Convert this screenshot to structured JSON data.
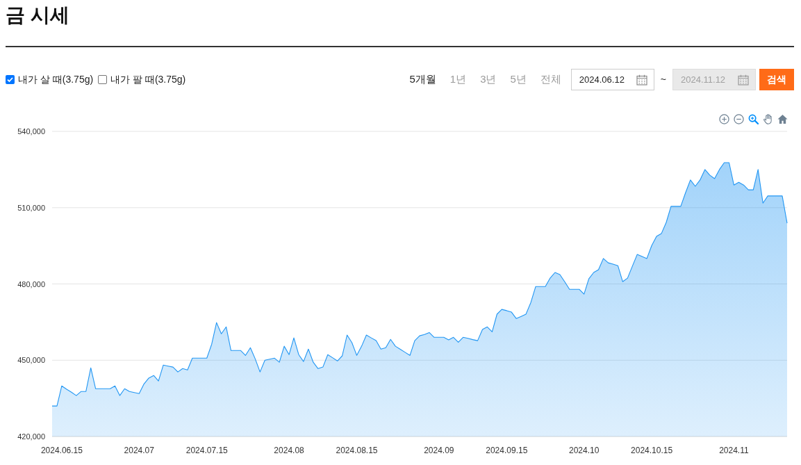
{
  "page": {
    "title": "금 시세"
  },
  "filters": [
    {
      "label": "내가 살 때(3.75g)",
      "checked": true
    },
    {
      "label": "내가 팔 때(3.75g)",
      "checked": false
    }
  ],
  "periods": [
    {
      "label": "5개월",
      "selected": true
    },
    {
      "label": "1년",
      "selected": false
    },
    {
      "label": "3년",
      "selected": false
    },
    {
      "label": "5년",
      "selected": false
    },
    {
      "label": "전체",
      "selected": false
    }
  ],
  "date_range": {
    "start": {
      "value": "2024.06.12",
      "disabled": false
    },
    "separator": "~",
    "end": {
      "value": "2024.11.12",
      "disabled": true
    }
  },
  "search_button": {
    "label": "검색"
  },
  "chart": {
    "tools": [
      {
        "kind": "zoom_in",
        "selected": false
      },
      {
        "kind": "zoom_out",
        "selected": false
      },
      {
        "kind": "zoom",
        "selected": true
      },
      {
        "kind": "pan",
        "selected": false
      },
      {
        "kind": "reset",
        "selected": false
      }
    ],
    "chart_data": {
      "type": "area",
      "grid": true,
      "categories": [
        null,
        null,
        "2024.06.15",
        null,
        null,
        null,
        null,
        null,
        null,
        null,
        null,
        null,
        null,
        null,
        null,
        null,
        null,
        null,
        "2024.07",
        null,
        null,
        null,
        null,
        null,
        null,
        null,
        null,
        null,
        null,
        null,
        null,
        null,
        "2024.07.15",
        null,
        null,
        null,
        null,
        null,
        null,
        null,
        null,
        null,
        null,
        null,
        null,
        null,
        null,
        null,
        null,
        "2024.08",
        null,
        null,
        null,
        null,
        null,
        null,
        null,
        null,
        null,
        null,
        null,
        null,
        null,
        "2024.08.15",
        null,
        null,
        null,
        null,
        null,
        null,
        null,
        null,
        null,
        null,
        null,
        null,
        null,
        null,
        null,
        null,
        "2024.09",
        null,
        null,
        null,
        null,
        null,
        null,
        null,
        null,
        null,
        null,
        null,
        null,
        null,
        "2024.09.15",
        null,
        null,
        null,
        null,
        null,
        null,
        null,
        null,
        null,
        null,
        null,
        null,
        null,
        null,
        null,
        "2024.10",
        null,
        null,
        null,
        null,
        null,
        null,
        null,
        null,
        null,
        null,
        null,
        null,
        null,
        "2024.10.15",
        null,
        null,
        null,
        null,
        null,
        null,
        null,
        null,
        null,
        null,
        null,
        null,
        null,
        null,
        null,
        null,
        "2024.11",
        null,
        null,
        null,
        null,
        null,
        null,
        null,
        null,
        null,
        null,
        null
      ],
      "series": [
        {
          "color": "#2196f3",
          "values": [
            432000,
            432000,
            439900,
            438600,
            437400,
            436100,
            437700,
            437700,
            447000,
            438800,
            438800,
            438800,
            438800,
            439900,
            436100,
            438800,
            437700,
            437300,
            436900,
            440700,
            443000,
            444000,
            441800,
            448100,
            447700,
            447300,
            445400,
            446700,
            446200,
            450800,
            450800,
            450800,
            450800,
            456300,
            464800,
            460400,
            463100,
            453800,
            453800,
            453800,
            451900,
            454900,
            450600,
            445400,
            450000,
            450400,
            450800,
            449200,
            455500,
            452200,
            458800,
            452200,
            449500,
            454400,
            449200,
            446700,
            447300,
            452200,
            451000,
            449700,
            451700,
            459900,
            456900,
            451900,
            455500,
            459900,
            458800,
            457700,
            454400,
            454900,
            458200,
            455500,
            454300,
            453100,
            451900,
            457700,
            459600,
            460100,
            460900,
            459000,
            459000,
            459000,
            458000,
            459000,
            457100,
            459000,
            458600,
            458100,
            457700,
            462100,
            463100,
            461200,
            468100,
            470000,
            469500,
            468900,
            466400,
            467200,
            468100,
            472700,
            479000,
            479000,
            479000,
            482300,
            484500,
            483700,
            480900,
            477900,
            477900,
            477900,
            476000,
            482000,
            484500,
            485600,
            490000,
            488300,
            487800,
            487200,
            480900,
            482300,
            487000,
            491600,
            490800,
            490000,
            495100,
            498700,
            499800,
            504200,
            510500,
            510500,
            510500,
            515900,
            520900,
            518400,
            520900,
            525000,
            522800,
            521400,
            525000,
            527700,
            527700,
            518900,
            520000,
            518900,
            517000,
            517000,
            525000,
            511800,
            514600,
            514600,
            514600,
            514600,
            503900
          ]
        }
      ],
      "ylim": [
        420000,
        540000
      ],
      "yticks": [
        {
          "value": 420000,
          "label": "420,000"
        },
        {
          "value": 450000,
          "label": "450,000"
        },
        {
          "value": 480000,
          "label": "480,000"
        },
        {
          "value": 510000,
          "label": "510,000"
        },
        {
          "value": 540000,
          "label": "540,000"
        }
      ]
    }
  }
}
